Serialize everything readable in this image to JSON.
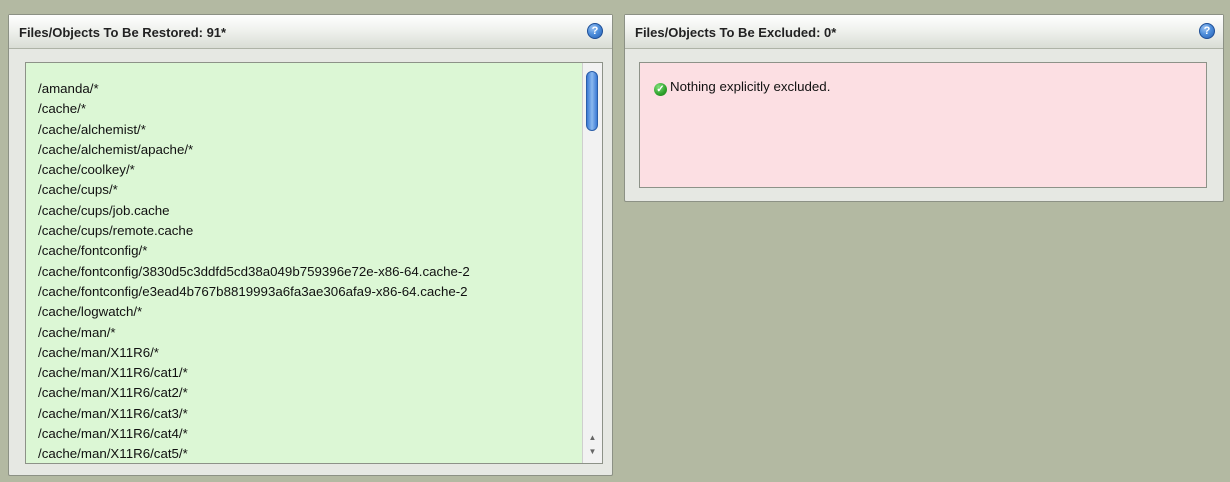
{
  "restored_panel": {
    "title": "Files/Objects To Be Restored: 91*",
    "help_icon": "?",
    "files": [
      "/amanda/*",
      "/cache/*",
      "/cache/alchemist/*",
      "/cache/alchemist/apache/*",
      "/cache/coolkey/*",
      "/cache/cups/*",
      "/cache/cups/job.cache",
      "/cache/cups/remote.cache",
      "/cache/fontconfig/*",
      "/cache/fontconfig/3830d5c3ddfd5cd38a049b759396e72e-x86-64.cache-2",
      "/cache/fontconfig/e3ead4b767b8819993a6fa3ae306afa9-x86-64.cache-2",
      "/cache/logwatch/*",
      "/cache/man/*",
      "/cache/man/X11R6/*",
      "/cache/man/X11R6/cat1/*",
      "/cache/man/X11R6/cat2/*",
      "/cache/man/X11R6/cat3/*",
      "/cache/man/X11R6/cat4/*",
      "/cache/man/X11R6/cat5/*"
    ],
    "scroll_up_glyph": "▲",
    "scroll_down_glyph": "▼"
  },
  "excluded_panel": {
    "title": "Files/Objects To Be Excluded: 0*",
    "help_icon": "?",
    "message": "Nothing explicitly excluded.",
    "check_glyph": "✓"
  },
  "colors": {
    "page_background": "#b3b9a2",
    "restored_list_background": "#dcf7d5",
    "excluded_box_background": "#fcdfe3",
    "help_icon_blue": "#4f8fdb",
    "check_icon_green": "#2ea12b"
  },
  "icons": {
    "help": "help-icon",
    "check": "check-circle-icon"
  }
}
